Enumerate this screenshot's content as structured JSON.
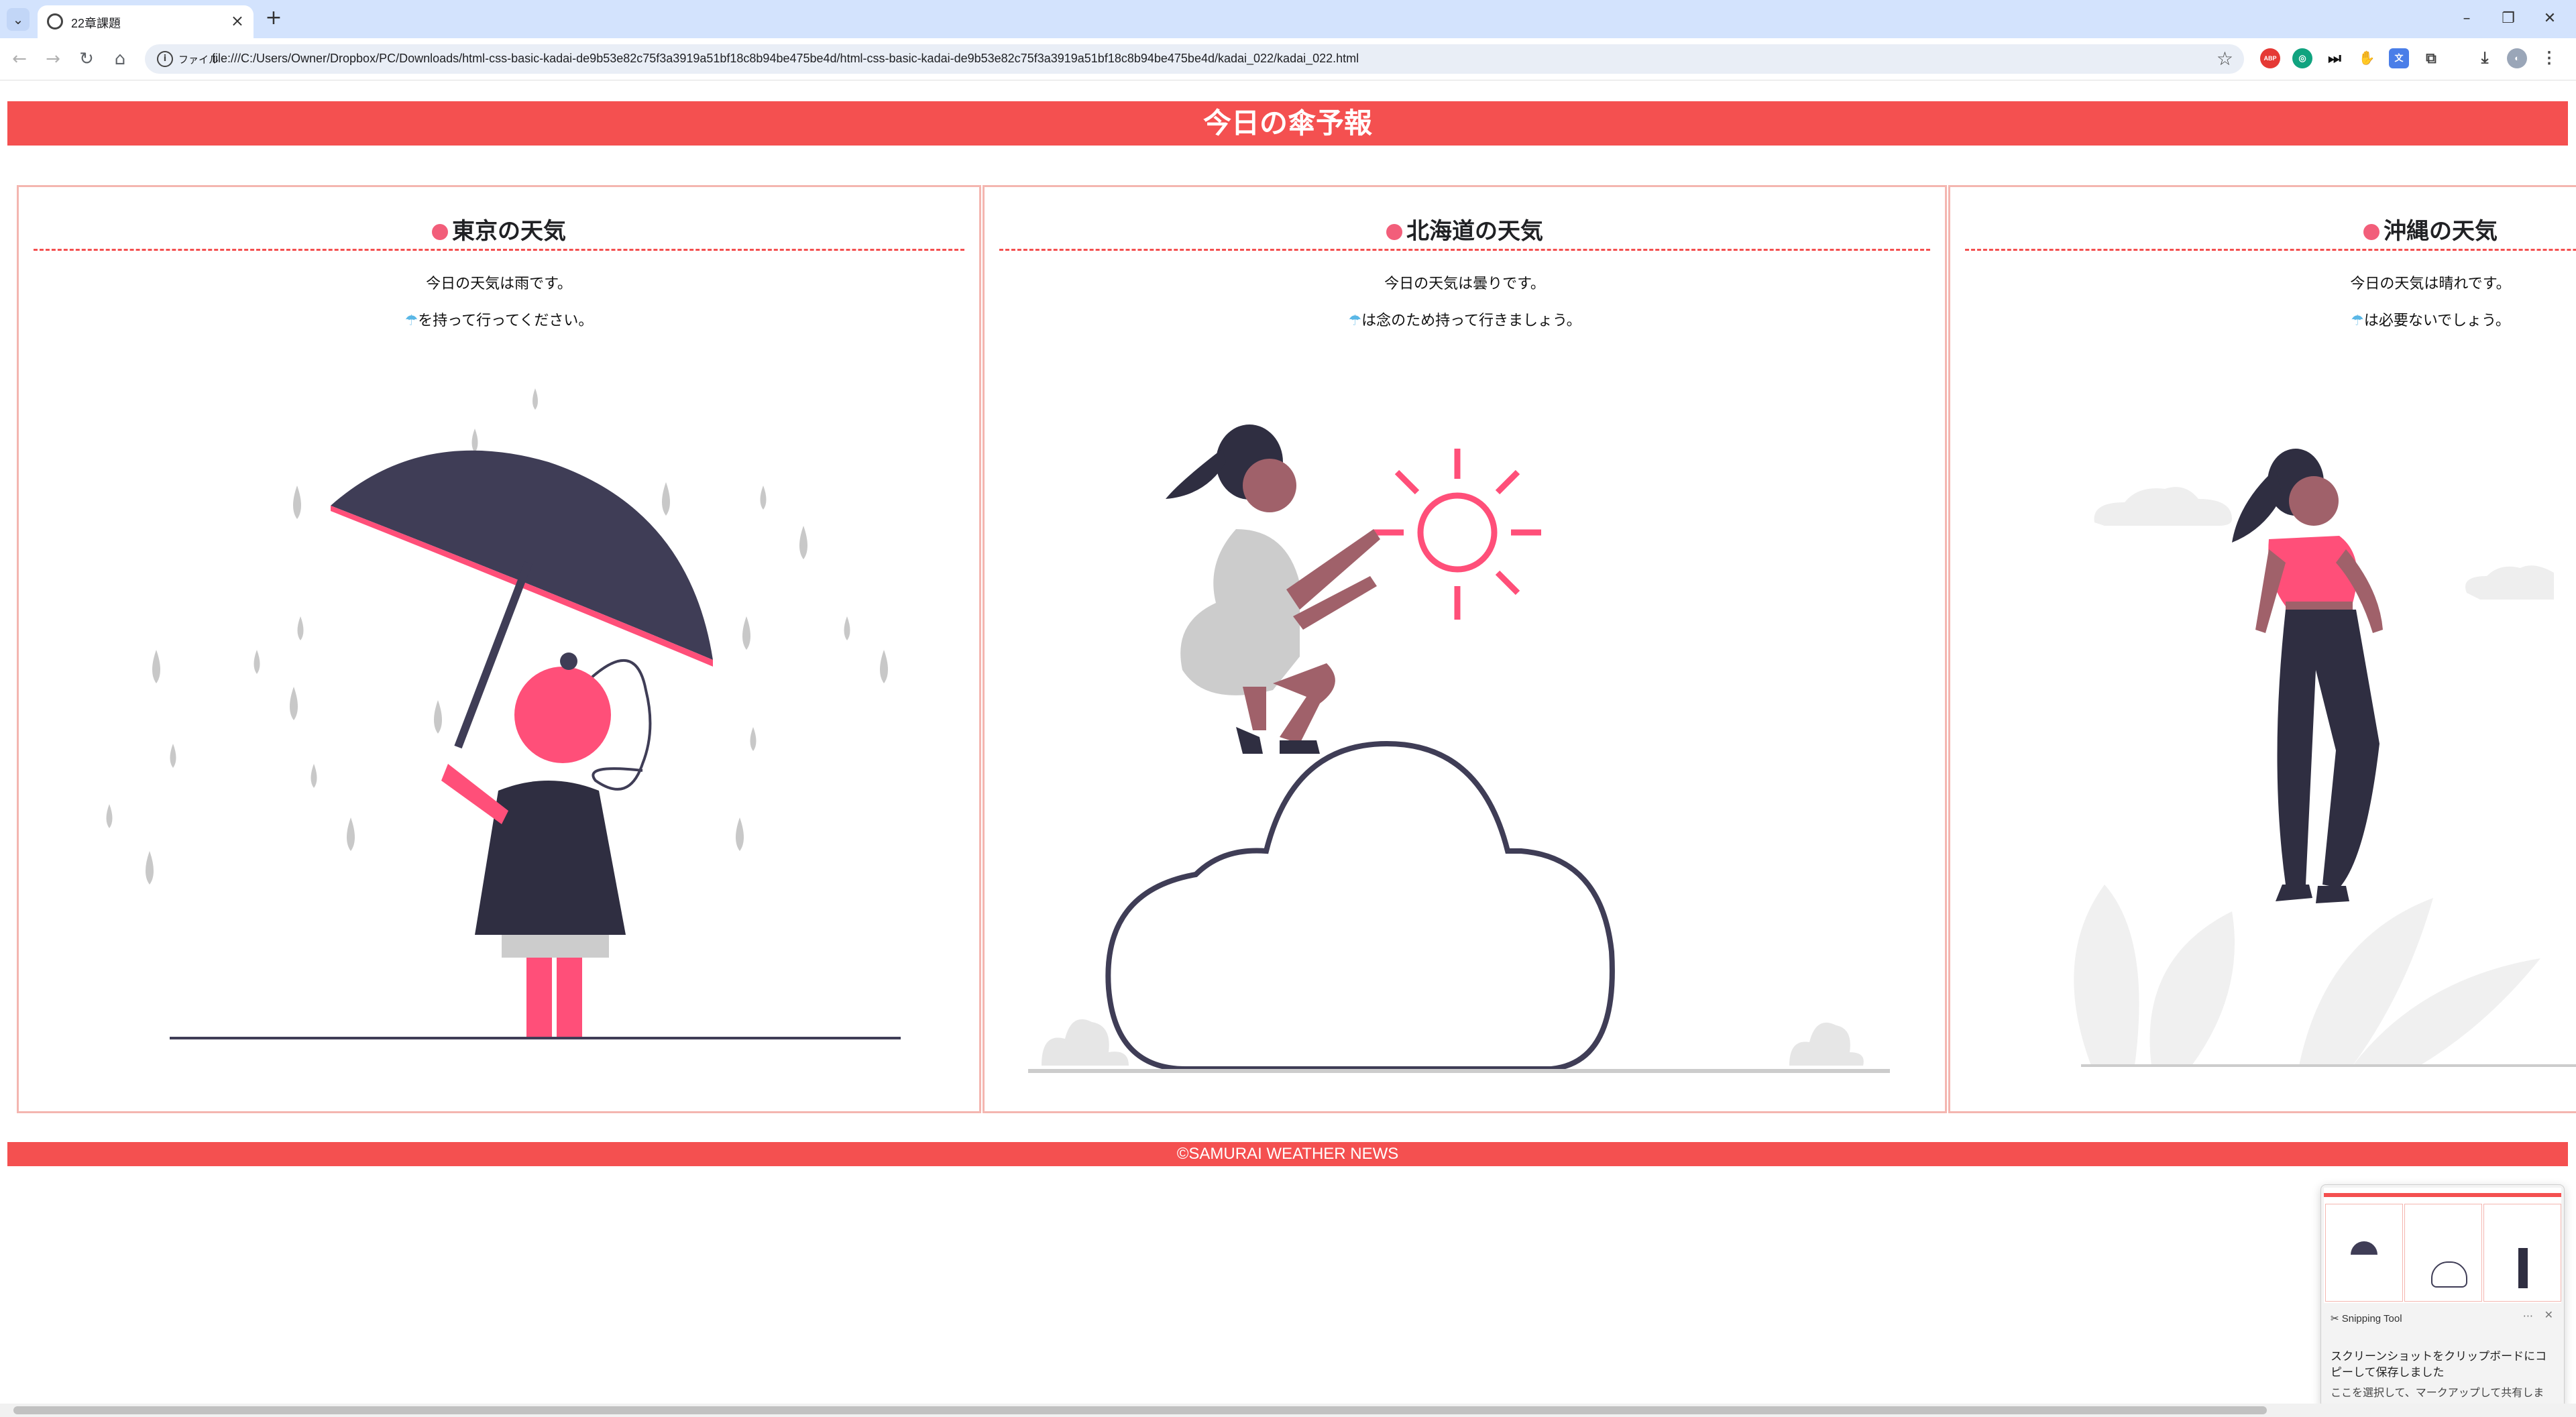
{
  "browser": {
    "tab_title": "22章課題",
    "tab_close": "×",
    "new_tab": "+",
    "site_chip": "ファイル",
    "url": "file:///C:/Users/Owner/Dropbox/PC/Downloads/html-css-basic-kadai-de9b53e82c75f3a3919a51bf18c8b94be475be4d/html-css-basic-kadai-de9b53e82c75f3a3919a51bf18c8b94be475be4d/kadai_022/kadai_022.html",
    "extension_badge": "ABP"
  },
  "page": {
    "header": "今日の傘予報",
    "footer": "©SAMURAI WEATHER NEWS",
    "cards": [
      {
        "title": "東京の天気",
        "weather": "今日の天気は雨です。",
        "umbrella_icon": "☂",
        "advice": "を持って行ってください。",
        "illustration": "woman-with-umbrella-in-rain"
      },
      {
        "title": "北海道の天気",
        "weather": "今日の天気は曇りです。",
        "umbrella_icon": "☂",
        "advice": "は念のため持って行きましょう。",
        "illustration": "woman-climbing-cloud-to-sun"
      },
      {
        "title": "沖縄の天気",
        "weather": "今日の天気は晴れです。",
        "umbrella_icon": "☂",
        "advice": "は必要ないでしょう。",
        "illustration": "woman-walking-sunny"
      }
    ]
  },
  "snipping_tool": {
    "app": "Snipping Tool",
    "message": "スクリーンショットをクリップボードにコピーして保存しました",
    "sub": "ここを選択して、マークアップして共有します。"
  },
  "colors": {
    "brand": "#f45050",
    "card_border": "#f4b6b0",
    "accent_pink": "#f25e7a",
    "dark_navy": "#3f3d56"
  }
}
